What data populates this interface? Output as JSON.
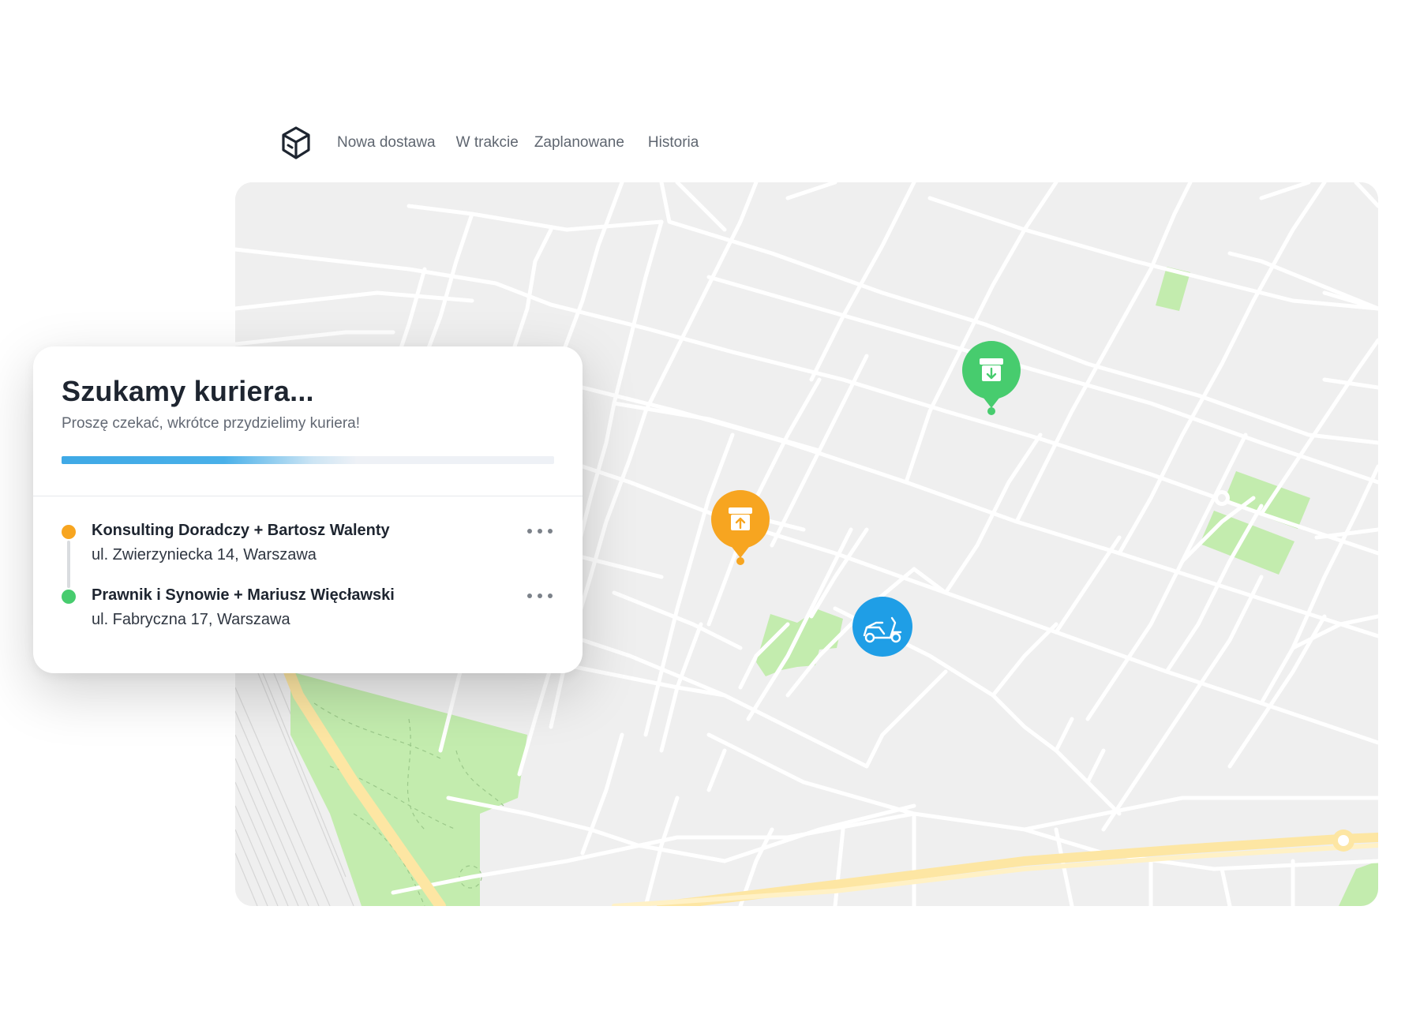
{
  "nav": {
    "logo_icon": "package-box-icon",
    "items": [
      "Nowa dostawa",
      "W trakcie",
      "Zaplanowane",
      "Historia"
    ]
  },
  "card": {
    "title": "Szukamy kuriera...",
    "subtitle": "Proszę czekać, wkrótce przydzielimy kuriera!",
    "progress": 0.6,
    "stops": [
      {
        "name": "Konsulting Doradczy + Bartosz Walenty",
        "address": "ul. Zwierzyniecka 14, Warszawa",
        "color": "#f7a520",
        "type": "pickup"
      },
      {
        "name": "Prawnik i Synowie + Mariusz Więcławski",
        "address": "ul. Fabryczna 17, Warszawa",
        "color": "#47cc6e",
        "type": "dropoff"
      }
    ],
    "more_icon": "more-horizontal-icon"
  },
  "map": {
    "markers": [
      {
        "kind": "pickup",
        "icon": "box-upload-icon",
        "color": "#f7a520"
      },
      {
        "kind": "dropoff",
        "icon": "box-download-icon",
        "color": "#47cc6e"
      },
      {
        "kind": "courier",
        "icon": "scooter-icon",
        "color": "#1f9ee6"
      }
    ],
    "colors": {
      "background": "#efefef",
      "road": "#ffffff",
      "park": "#c3ecae",
      "highway": "#fde6a3"
    }
  }
}
